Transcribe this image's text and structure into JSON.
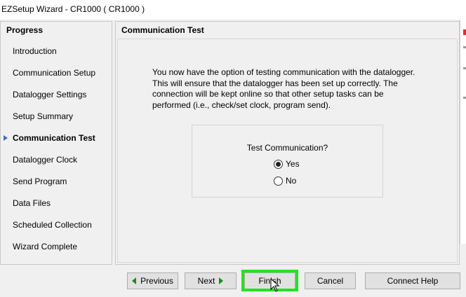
{
  "window": {
    "title": "EZSetup Wizard - CR1000 ( CR1000 )"
  },
  "progress": {
    "title": "Progress",
    "steps": [
      {
        "label": "Introduction",
        "active": false
      },
      {
        "label": "Communication Setup",
        "active": false
      },
      {
        "label": "Datalogger Settings",
        "active": false
      },
      {
        "label": "Setup Summary",
        "active": false
      },
      {
        "label": "Communication Test",
        "active": true
      },
      {
        "label": "Datalogger Clock",
        "active": false
      },
      {
        "label": "Send Program",
        "active": false
      },
      {
        "label": "Data Files",
        "active": false
      },
      {
        "label": "Scheduled Collection",
        "active": false
      },
      {
        "label": "Wizard Complete",
        "active": false
      }
    ]
  },
  "main": {
    "title": "Communication Test",
    "description": "You now have the option of testing communication with the datalogger.\n This will ensure that the datalogger has been set up correctly.  The\nconnection will be kept online so that other setup tasks can be\nperformed (i.e., check/set clock, program send).",
    "test_question": "Test Communication?",
    "options": [
      {
        "label": "Yes",
        "checked": true
      },
      {
        "label": "No",
        "checked": false
      }
    ]
  },
  "buttons": {
    "previous": "Previous",
    "next": "Next",
    "finish": "Finish",
    "cancel": "Cancel",
    "connect_help": "Connect Help"
  },
  "colors": {
    "highlight": "#22e322",
    "arrow": "#1e8a1e",
    "active_marker": "#3b6fc4"
  },
  "icons": {
    "previous": "arrow-left-icon",
    "next": "arrow-right-icon",
    "active_step": "current-step-arrow-icon",
    "cursor": "mouse-pointer-icon"
  }
}
